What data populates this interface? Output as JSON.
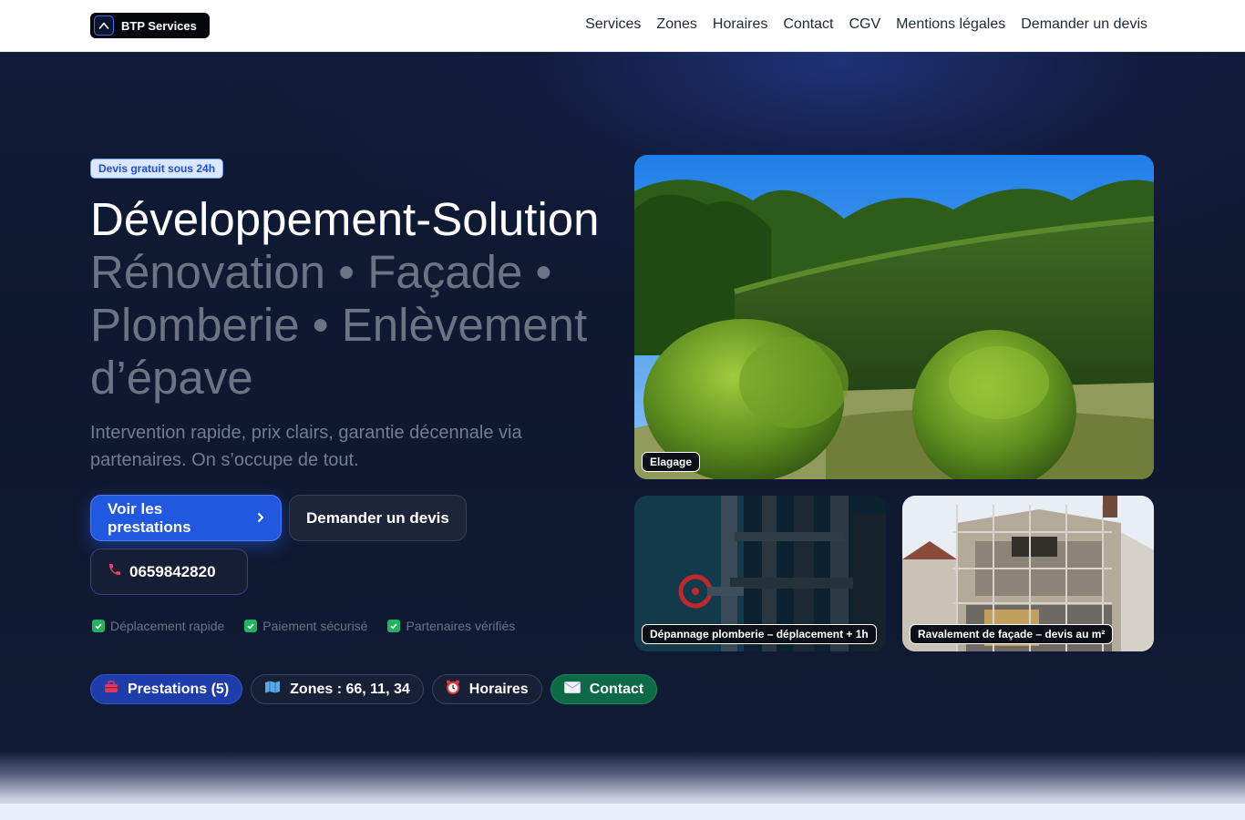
{
  "brand": {
    "name": "BTP Services",
    "icon": "chevron-up-icon"
  },
  "nav": {
    "links": [
      "Services",
      "Zones",
      "Horaires",
      "Contact",
      "CGV",
      "Mentions légales",
      "Demander un devis"
    ]
  },
  "hero": {
    "badge": "Devis gratuit sous 24h",
    "title_main": "Développement-Solution",
    "title_sub": "Rénovation • Façade • Plomberie • Enlèvement d’épave",
    "lede": "Intervention rapide, prix clairs, garantie décennale via partenaires. On s’occupe de tout.",
    "cta_primary": "Voir les prestations",
    "cta_secondary": "Demander un devis",
    "phone": "0659842820",
    "checks": [
      "Déplacement rapide",
      "Paiement sécurisé",
      "Partenaires vérifiés"
    ],
    "chips": [
      {
        "label": "Prestations (5)",
        "icon": "toolbox-icon"
      },
      {
        "label": "Zones : 66, 11, 34",
        "icon": "map-icon"
      },
      {
        "label": "Horaires",
        "icon": "alarm-clock-icon"
      },
      {
        "label": "Contact",
        "icon": "envelope-icon"
      }
    ]
  },
  "gallery": {
    "main_caption": "Elagage",
    "plumbing_caption": "Dépannage plomberie – déplacement + 1h",
    "facade_caption": "Ravalement de façade – devis au m²"
  },
  "colors": {
    "accent": "#2158e0",
    "hero_bg": "#111a34",
    "success": "#22b35f",
    "contact_chip": "#0e6a46"
  }
}
